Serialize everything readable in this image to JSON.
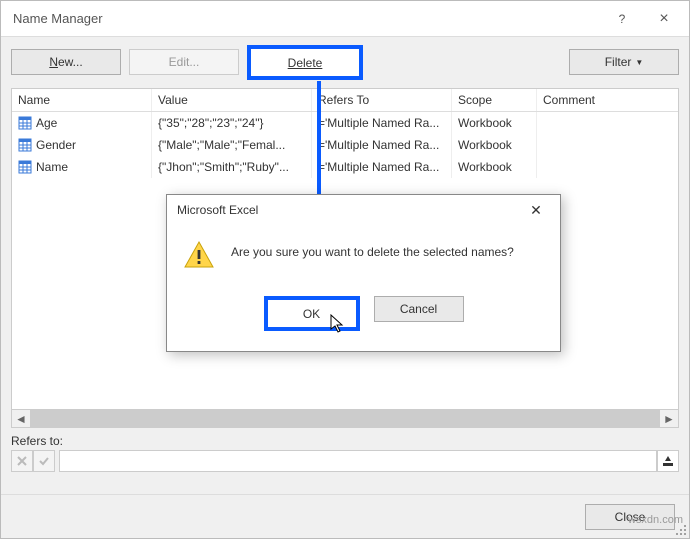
{
  "window": {
    "title": "Name Manager",
    "help": "?",
    "close": "×"
  },
  "toolbar": {
    "new": "New...",
    "edit": "Edit...",
    "delete": "Delete",
    "filter": "Filter"
  },
  "columns": {
    "name": "Name",
    "value": "Value",
    "refers": "Refers To",
    "scope": "Scope",
    "comment": "Comment"
  },
  "rows": [
    {
      "name": "Age",
      "value": "{\"35\";\"28\";\"23\";\"24\"}",
      "refers": "='Multiple Named Ra...",
      "scope": "Workbook",
      "comment": ""
    },
    {
      "name": "Gender",
      "value": "{\"Male\";\"Male\";\"Femal...",
      "refers": "='Multiple Named Ra...",
      "scope": "Workbook",
      "comment": ""
    },
    {
      "name": "Name",
      "value": "{\"Jhon\";\"Smith\";\"Ruby\"...",
      "refers": "='Multiple Named Ra...",
      "scope": "Workbook",
      "comment": ""
    }
  ],
  "refers_label": "Refers to:",
  "footer": {
    "close": "Close"
  },
  "modal": {
    "title": "Microsoft Excel",
    "message": "Are you sure you want to delete the selected names?",
    "ok": "OK",
    "cancel": "Cancel"
  },
  "watermark": "wsxdn.com"
}
